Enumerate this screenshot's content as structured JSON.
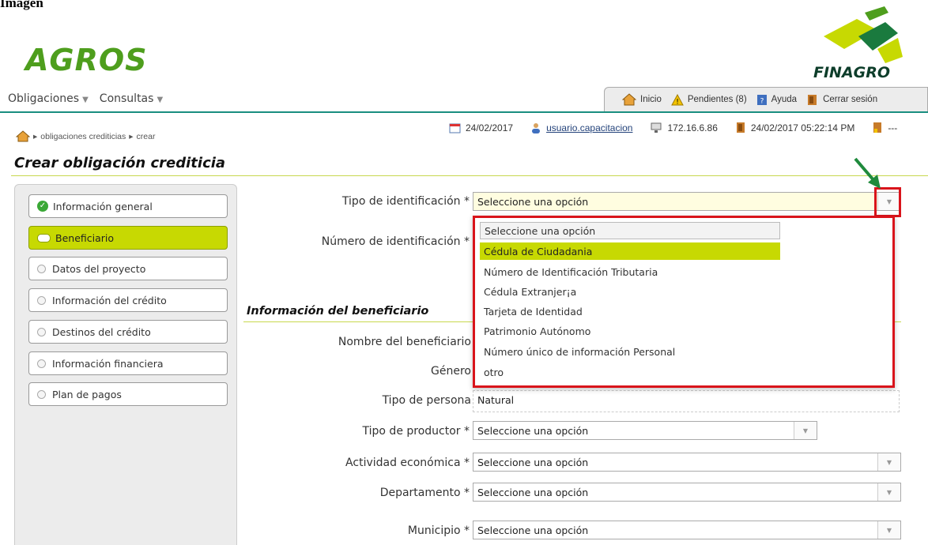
{
  "doc_heading": "Imagen",
  "logos": {
    "app": "AGROS",
    "brand": "FINAGRO"
  },
  "menu": [
    {
      "label": "Obligaciones"
    },
    {
      "label": "Consultas"
    }
  ],
  "toolbar": [
    {
      "label": "Inicio",
      "icon": "home-icon"
    },
    {
      "label": "Pendientes (8)",
      "icon": "warning-icon"
    },
    {
      "label": "Ayuda",
      "icon": "help-icon"
    },
    {
      "label": "Cerrar sesión",
      "icon": "logout-icon"
    }
  ],
  "breadcrumb": {
    "items": [
      "obligaciones crediticias",
      "crear"
    ]
  },
  "status": {
    "date": "24/02/2017",
    "user": "usuario.capacitacion",
    "ip": "172.16.6.86",
    "datetime": "24/02/2017 05:22:14 PM",
    "extra": "---"
  },
  "page_title": "Crear obligación crediticia",
  "sidebar": {
    "items": [
      {
        "label": "Información general",
        "state": "done"
      },
      {
        "label": "Beneficiario",
        "state": "active"
      },
      {
        "label": "Datos del proyecto",
        "state": "pending"
      },
      {
        "label": "Información del crédito",
        "state": "pending"
      },
      {
        "label": "Destinos del crédito",
        "state": "pending"
      },
      {
        "label": "Información financiera",
        "state": "pending"
      },
      {
        "label": "Plan de pagos",
        "state": "pending"
      }
    ]
  },
  "form": {
    "tipo_identificacion": {
      "label": "Tipo de identificación *",
      "value": "Seleccione una opción"
    },
    "numero_identificacion": {
      "label": "Número de identificación *"
    },
    "section_title": "Información del beneficiario",
    "nombre": {
      "label": "Nombre del beneficiario"
    },
    "genero": {
      "label": "Género"
    },
    "tipo_persona": {
      "label": "Tipo de persona",
      "value": "Natural"
    },
    "tipo_productor": {
      "label": "Tipo de productor *",
      "value": "Seleccione una opción"
    },
    "actividad": {
      "label": "Actividad económica *",
      "value": "Seleccione una opción"
    },
    "departamento": {
      "label": "Departamento *",
      "value": "Seleccione una opción"
    },
    "municipio": {
      "label": "Municipio *",
      "value": "Seleccione una opción"
    }
  },
  "dropdown": {
    "options": [
      "Seleccione una opción",
      "Cédula de Ciudadania",
      "Número de Identificación Tributaria",
      "Cédula Extranjer¡a",
      "Tarjeta de Identidad",
      "Patrimonio Autónomo",
      "Número único de información Personal",
      "otro"
    ],
    "highlighted_index": 1
  },
  "colors": {
    "accent": "#c7d902",
    "teal": "#1a8e80",
    "highlight_red": "#d9141b",
    "logo_green": "#4e9e1d"
  }
}
